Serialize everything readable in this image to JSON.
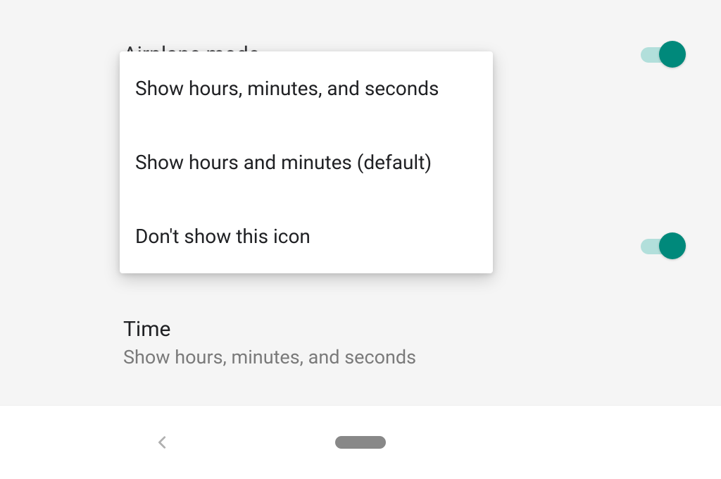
{
  "settings": {
    "airplane": {
      "label": "Airplane mode",
      "enabled": true
    },
    "secondToggle": {
      "enabled": true
    }
  },
  "popup": {
    "options": [
      "Show hours, minutes, and seconds",
      "Show hours and minutes (default)",
      "Don't show this icon"
    ]
  },
  "time": {
    "title": "Time",
    "subtitle": "Show hours, minutes, and seconds"
  },
  "colors": {
    "accent": "#00897b",
    "accentLight": "#b2dfdb"
  }
}
